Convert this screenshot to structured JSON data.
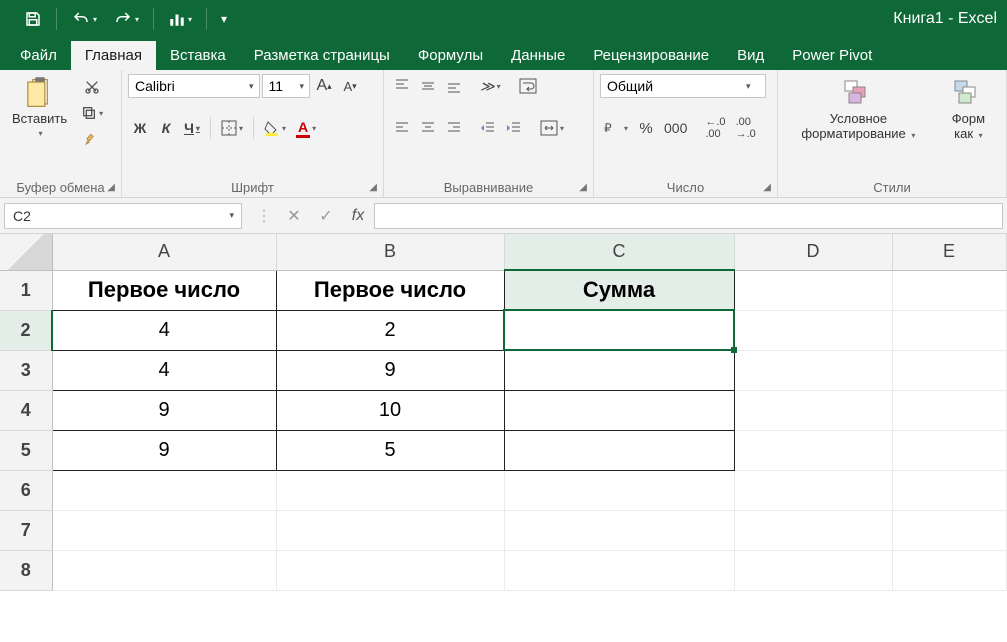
{
  "title": "Книга1 - Excel",
  "tabs": [
    "Файл",
    "Главная",
    "Вставка",
    "Разметка страницы",
    "Формулы",
    "Данные",
    "Рецензирование",
    "Вид",
    "Power Pivot"
  ],
  "active_tab_index": 1,
  "ribbon": {
    "clipboard": {
      "paste": "Вставить",
      "label": "Буфер обмена"
    },
    "font": {
      "name": "Calibri",
      "size": "11",
      "bold": "Ж",
      "italic": "К",
      "underline": "Ч",
      "label": "Шрифт"
    },
    "alignment": {
      "label": "Выравнивание"
    },
    "number": {
      "format": "Общий",
      "label": "Число"
    },
    "styles": {
      "cond": "Условное форматирование",
      "format_as": "Форм как",
      "label": "Стили"
    }
  },
  "formula_bar": {
    "name_box": "C2",
    "fx": "fx",
    "formula": ""
  },
  "columns": [
    "A",
    "B",
    "C",
    "D",
    "E"
  ],
  "rows": [
    "1",
    "2",
    "3",
    "4",
    "5",
    "6",
    "7",
    "8"
  ],
  "selected": {
    "col": 2,
    "row": 1
  },
  "data": {
    "A1": "Первое число",
    "B1": "Первое число",
    "C1": "Сумма",
    "A2": "4",
    "B2": "2",
    "A3": "4",
    "B3": "9",
    "A4": "9",
    "B4": "10",
    "A5": "9",
    "B5": "5"
  }
}
